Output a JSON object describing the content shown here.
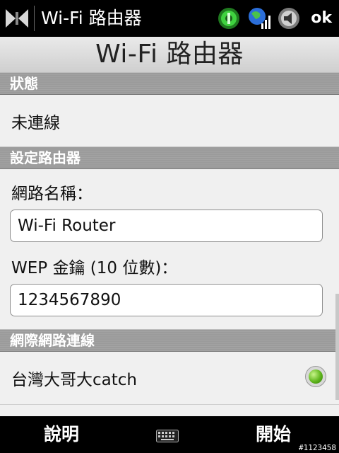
{
  "statusbar": {
    "title": "Wi-Fi 路由器",
    "ok_label": "ok",
    "icons": [
      "start-icon",
      "connectivity-icon",
      "signal-icon",
      "volume-icon"
    ]
  },
  "header": {
    "title": "Wi-Fi 路由器"
  },
  "status_section": {
    "label": "狀態",
    "value": "未連線"
  },
  "router_section": {
    "label": "設定路由器",
    "network_name_label": "網路名稱：",
    "network_name_value": "Wi-Fi Router",
    "wep_key_label": "WEP 金鑰 (10 位數)：",
    "wep_key_value": "1234567890"
  },
  "internet_section": {
    "label": "網際網路連線",
    "connection_name": "台灣大哥大catch",
    "connection_selected": true
  },
  "softkeys": {
    "left": "說明",
    "right": "開始"
  },
  "footer_id": "#1123458",
  "colors": {
    "bar_bg": "#000000",
    "section_bg": "#9b9b9b",
    "accent_green": "#5fb51c"
  }
}
